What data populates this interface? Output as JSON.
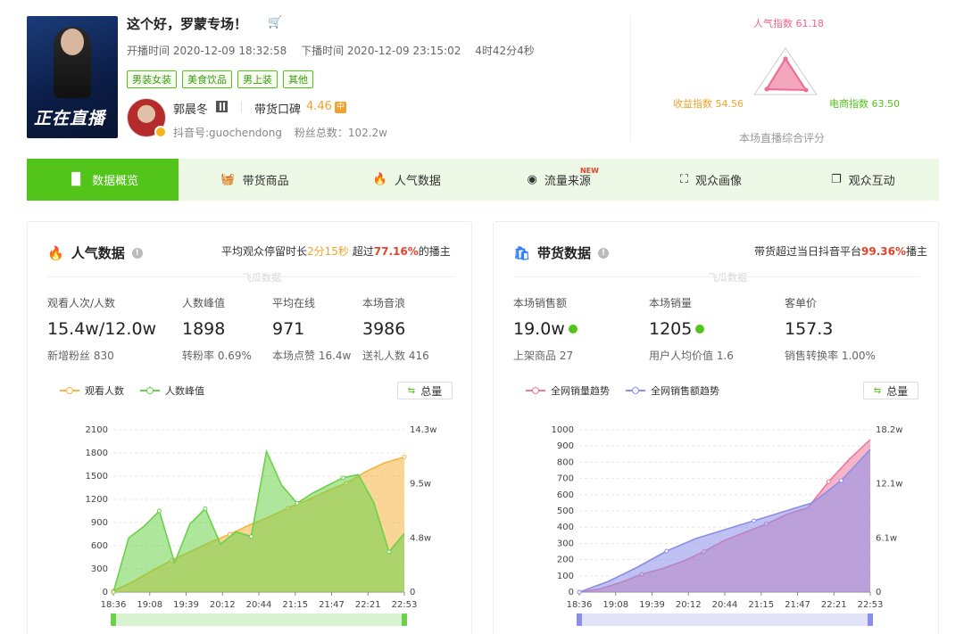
{
  "header": {
    "title": "这个好，罗蒙专场！",
    "start_time": "开播时间  2020-12-09 18:32:58",
    "end_time": "下播时间  2020-12-09 23:15:02",
    "duration": "4时42分4秒",
    "cover_text": "正在直播",
    "tags": [
      "男装女装",
      "美食饮品",
      "男上装",
      "其他"
    ],
    "anchor_name": "郭晨冬",
    "koubei_label": "带货口碑",
    "koubei_value": "4.46",
    "koubei_badge": "中",
    "douyin_id": "抖音号:guochendong",
    "fans": "粉丝总数：102.2w"
  },
  "radar": {
    "popularity": "人气指数 61.18",
    "revenue": "收益指数 54.56",
    "ecommerce": "电商指数 63.50",
    "caption": "本场直播综合评分",
    "colors": {
      "popularity": "#f0648e",
      "revenue": "#f0a22a",
      "ecommerce": "#52c41a"
    }
  },
  "tabs": [
    {
      "label": "数据概览",
      "icon": "bar-chart-icon",
      "active": true
    },
    {
      "label": "带货商品",
      "icon": "basket-icon"
    },
    {
      "label": "人气数据",
      "icon": "flame-icon"
    },
    {
      "label": "流量来源",
      "icon": "pulse-icon",
      "badge": "NEW"
    },
    {
      "label": "观众画像",
      "icon": "portrait-icon"
    },
    {
      "label": "观众互动",
      "icon": "chat-icon"
    }
  ],
  "left_panel": {
    "title": "人气数据",
    "note_prefix": "平均观众停留时长",
    "note_highlight": "2分15秒",
    "note_mid": "  超过",
    "note_percent": "77.16%",
    "note_suffix": "的播主",
    "watermark": "飞瓜数据",
    "metrics": [
      {
        "key": "观看人次/人数",
        "value": "15.4w/12.0w",
        "sub": "新增粉丝 830"
      },
      {
        "key": "人数峰值",
        "value": "1898",
        "sub": "转粉率 0.69%"
      },
      {
        "key": "平均在线",
        "value": "971",
        "sub": "本场点赞 16.4w"
      },
      {
        "key": "本场音浪",
        "value": "3986",
        "sub": "送礼人数 416"
      }
    ],
    "legend": [
      "观看人数",
      "人数峰值"
    ],
    "total_button": "总量"
  },
  "right_panel": {
    "title": "带货数据",
    "note_prefix": "带货超过当日抖音平台",
    "note_percent": "99.36%",
    "note_suffix": "播主",
    "watermark": "飞瓜数据",
    "metrics": [
      {
        "key": "本场销售额",
        "value": "19.0w",
        "sub": "上架商品 27",
        "check": true
      },
      {
        "key": "本场销量",
        "value": "1205",
        "sub": "用户人均价值 1.6",
        "check": true
      },
      {
        "key": "客单价",
        "value": "157.3",
        "sub": "销售转换率 1.00%"
      }
    ],
    "legend": [
      "全网销量趋势",
      "全网销售额趋势"
    ],
    "total_button": "总量"
  },
  "chart_data": [
    {
      "type": "area",
      "title": "",
      "x": [
        "18:36",
        "19:08",
        "19:39",
        "20:12",
        "20:44",
        "21:15",
        "21:47",
        "22:21",
        "22:53"
      ],
      "y_left": {
        "ticks": [
          0,
          300,
          600,
          900,
          1200,
          1500,
          1800,
          2100
        ],
        "range": [
          0,
          2100
        ]
      },
      "y_right": {
        "ticks": [
          "0",
          "4.8w",
          "9.5w",
          "14.3w"
        ],
        "range": [
          0,
          14.3
        ]
      },
      "series": [
        {
          "name": "观看人数",
          "color": "#f5b53f",
          "axis": "right",
          "values": [
            0.1,
            0.9,
            1.9,
            2.8,
            3.6,
            4.4,
            5.1,
            5.9,
            6.6,
            7.4,
            8.1,
            8.9,
            9.6,
            10.6,
            11.4,
            11.9
          ]
        },
        {
          "name": "人数峰值",
          "color": "#6cd14a",
          "axis": "left",
          "values": [
            0,
            700,
            850,
            1050,
            380,
            880,
            1080,
            620,
            780,
            720,
            1820,
            1380,
            1150,
            1280,
            1380,
            1480,
            1520,
            1160,
            520,
            760
          ]
        }
      ]
    },
    {
      "type": "area",
      "title": "",
      "x": [
        "18:36",
        "19:08",
        "19:39",
        "20:12",
        "20:44",
        "21:15",
        "21:47",
        "22:21",
        "22:53"
      ],
      "y_left": {
        "ticks": [
          0,
          100,
          200,
          300,
          400,
          500,
          600,
          700,
          800,
          900,
          1000
        ],
        "range": [
          0,
          1000
        ]
      },
      "y_right": {
        "ticks": [
          "0",
          "6.1w",
          "12.1w",
          "18.2w"
        ],
        "range": [
          0,
          18.2
        ]
      },
      "series": [
        {
          "name": "全网销量趋势",
          "color": "#f0789c",
          "axis": "left",
          "values": [
            0,
            20,
            60,
            110,
            145,
            190,
            250,
            320,
            370,
            420,
            480,
            520,
            680,
            820,
            940
          ]
        },
        {
          "name": "全网销售额趋势",
          "color": "#8a8ee8",
          "axis": "right",
          "values": [
            0,
            1.2,
            2.8,
            4.6,
            6.0,
            7.0,
            8.0,
            9.0,
            10.0,
            12.5,
            16.0
          ]
        }
      ]
    }
  ]
}
